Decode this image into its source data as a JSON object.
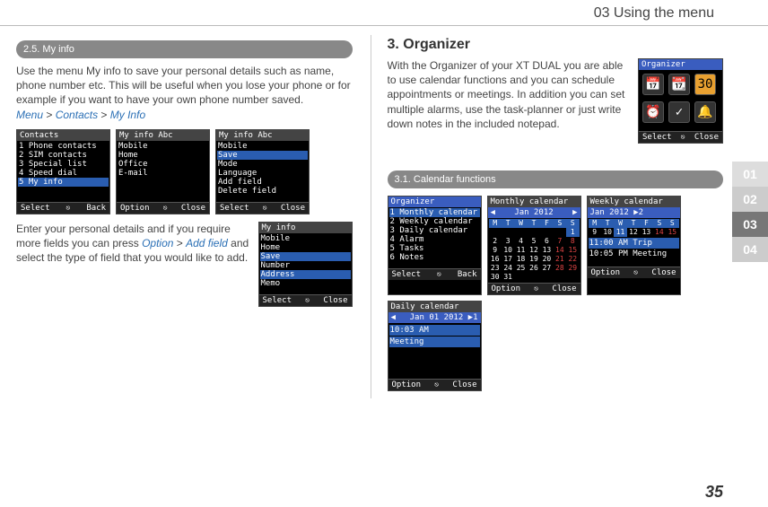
{
  "header": "03 Using the menu",
  "tabs": {
    "t01": "01",
    "t02": "02",
    "t03": "03",
    "t04": "04"
  },
  "page_number": "35",
  "left": {
    "sec25_title": "2.5. My info",
    "para1": "Use the menu My info to save your personal details such as name, phone number etc. This will be useful when you lose your phone or for example if you want to have your own phone number saved.",
    "menu_path": {
      "a": "Menu",
      "b": "Contacts",
      "c": "My Info"
    },
    "para2a": "Enter your personal details and if you require more fields you can press ",
    "para2b": "Option",
    "para2c": "Add field",
    "para2d": " and select the type of field that you would like to add.",
    "screens1": {
      "s1": {
        "title": "Contacts",
        "rows": [
          "1 Phone contacts",
          "2 SIM contacts",
          "3 Special list",
          "4 Speed dial",
          "5 My info"
        ],
        "hl": 4,
        "sk_l": "Select",
        "sk_r": "Back"
      },
      "s2": {
        "title": "My info            Abc",
        "rows": [
          "",
          "Mobile",
          "Home",
          "Office",
          "E-mail"
        ],
        "sk_l": "Option",
        "sk_r": "Close"
      },
      "s3": {
        "title": "My info            Abc",
        "rows": [
          "Mobile",
          "Save",
          "Mode",
          "Language",
          "Add field",
          "Delete field"
        ],
        "hl": 1,
        "sk_l": "Select",
        "sk_r": "Close"
      }
    },
    "screens2": {
      "s4": {
        "title": "My info",
        "rows": [
          "",
          "Mobile",
          "Home",
          "Save",
          "Number",
          "Address",
          "Memo"
        ],
        "hl": 5,
        "sk_l": "Select",
        "sk_r": "Close"
      }
    }
  },
  "right": {
    "h3": "3. Organizer",
    "para": "With the Organizer of your XT DUAL you are able to use calendar functions and you can schedule appointments or meetings. In addition you can set multiple alarms, use the task-planner or just write down notes in the included notepad.",
    "org_phone": {
      "title": "Organizer",
      "sk_l": "Select",
      "sk_r": "Close"
    },
    "sec31_title": "3.1. Calendar functions",
    "screens": {
      "s1": {
        "title": "Organizer",
        "rows": [
          "1 Monthly calendar",
          "2 Weekly calendar",
          "3 Daily calendar",
          "4 Alarm",
          "5 Tasks",
          "6 Notes"
        ],
        "hl": 0,
        "sk_l": "Select",
        "sk_r": "Back"
      },
      "s2": {
        "title": "Monthly calendar",
        "sub": "Jan 2012",
        "dow": [
          "M",
          "T",
          "W",
          "T",
          "F",
          "S",
          "S"
        ],
        "weeks": [
          [
            "",
            "",
            "",
            "",
            "",
            "",
            "1"
          ],
          [
            "2",
            "3",
            "4",
            "5",
            "6",
            "7",
            "8"
          ],
          [
            "9",
            "10",
            "11",
            "12",
            "13",
            "14",
            "15"
          ],
          [
            "16",
            "17",
            "18",
            "19",
            "20",
            "21",
            "22"
          ],
          [
            "23",
            "24",
            "25",
            "26",
            "27",
            "28",
            "29"
          ],
          [
            "30",
            "31",
            "",
            "",
            "",
            "",
            ""
          ]
        ],
        "sk_l": "Option",
        "sk_r": "Close"
      },
      "s3": {
        "title": "Weekly calendar",
        "sub": "Jan 2012        ▶2",
        "dow": [
          "M",
          "T",
          "W",
          "T",
          "F",
          "S",
          "S"
        ],
        "days": [
          "9",
          "10",
          "11",
          "12",
          "13",
          "14",
          "15"
        ],
        "e1": "11:00 AM Trip",
        "e2": "10:05 PM Meeting",
        "sk_l": "Option",
        "sk_r": "Close"
      },
      "s4": {
        "title": "Daily calendar",
        "sub": "Jan 01 2012    ▶1",
        "e1": "10:03 AM",
        "e2": "Meeting",
        "sk_l": "Option",
        "sk_r": "Close"
      }
    }
  }
}
